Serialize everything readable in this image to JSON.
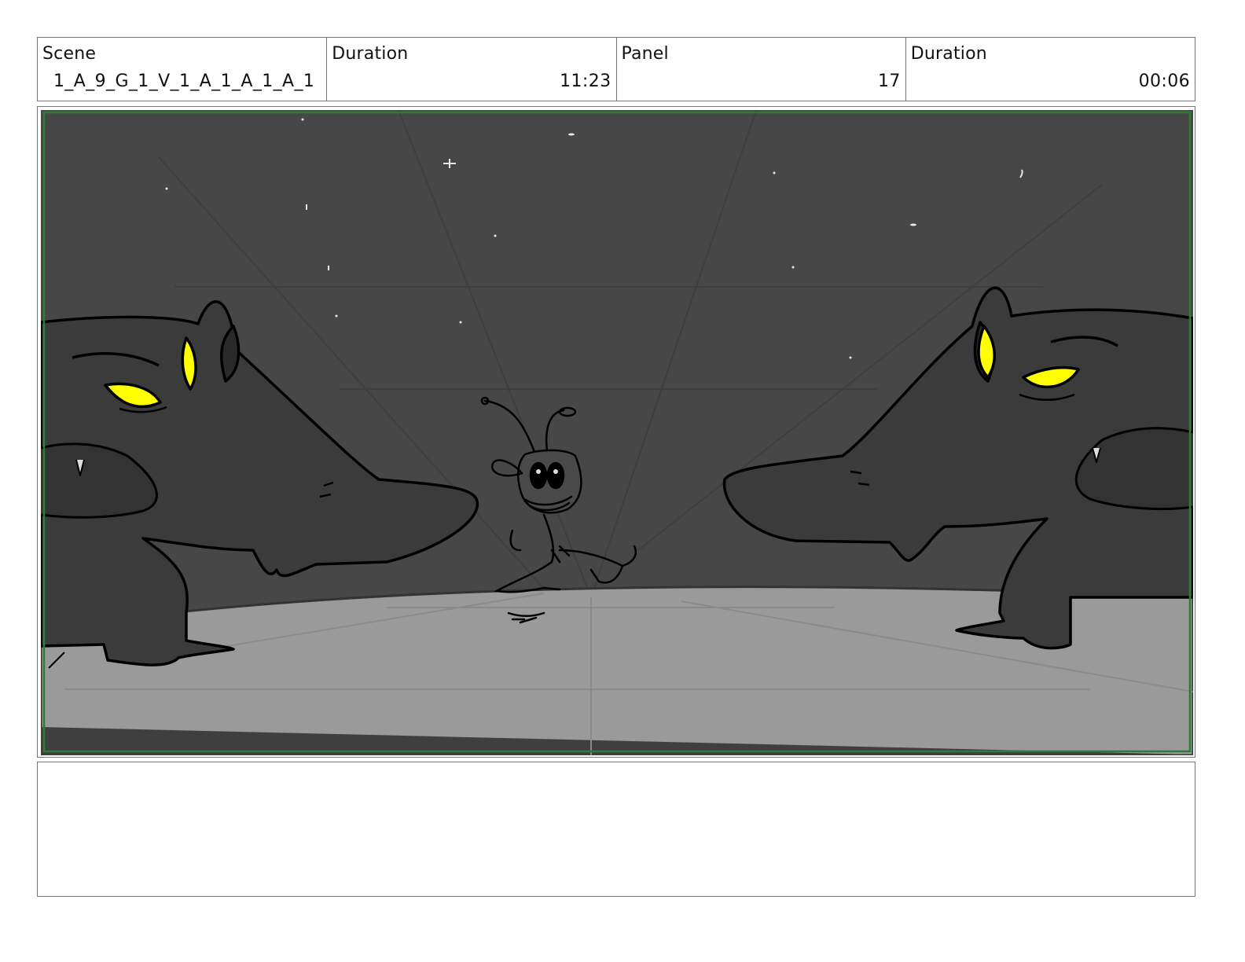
{
  "header": {
    "scene": {
      "label": "Scene",
      "value": "1_A_9_G_1_V_1_A_1_A_1_A_1"
    },
    "scene_duration": {
      "label": "Duration",
      "value": "11:23"
    },
    "panel": {
      "label": "Panel",
      "value": "17"
    },
    "panel_duration": {
      "label": "Duration",
      "value": "00:06"
    }
  },
  "notes": {
    "text": ""
  },
  "colors": {
    "sky": "#474747",
    "floor": "#9a9a9a",
    "creature": "#3a3a3a",
    "eyes": "#ffff00",
    "safe_frame": "#2e7d32",
    "border": "#777777"
  },
  "icons": [
    "wolf-creature-left",
    "wolf-creature-right",
    "bug-character"
  ]
}
